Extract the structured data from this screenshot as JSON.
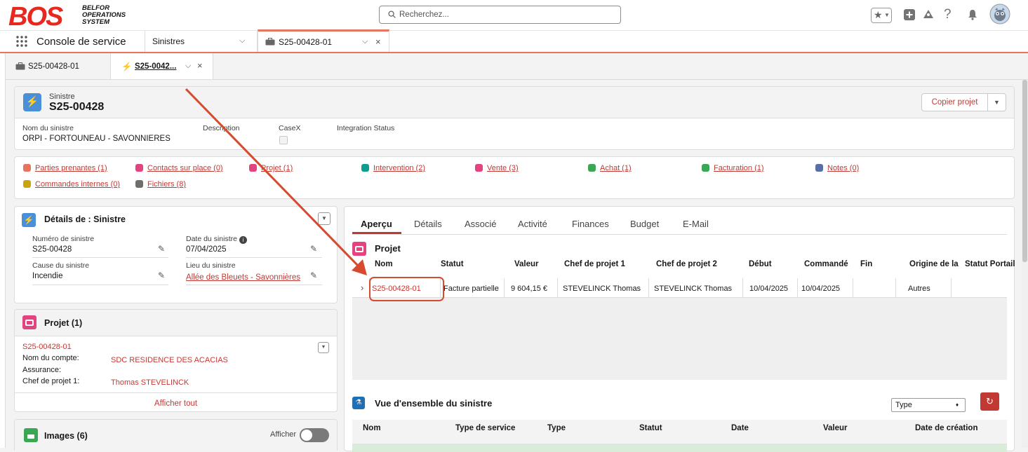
{
  "app": {
    "logo_text": "BOS",
    "logo_sub": [
      "BELFOR",
      "OPERATIONS",
      "SYSTEM"
    ],
    "search_placeholder": "Recherchez..."
  },
  "nav": {
    "console": "Console de service",
    "object_select": "Sinistres",
    "tab1": "S25-00428-01"
  },
  "subtabs": {
    "tab1": "S25-00428-01",
    "tab2": "S25-0042..."
  },
  "record": {
    "object_label": "Sinistre",
    "name": "S25-00428",
    "copy_button": "Copier projet",
    "fields": [
      {
        "label": "Nom du sinistre",
        "value": "ORPI - FORTOUNEAU - SAVONNIERES"
      },
      {
        "label": "Description",
        "value": ""
      },
      {
        "label": "CaseX",
        "value": ""
      },
      {
        "label": "Integration Status",
        "value": ""
      }
    ]
  },
  "related_links": [
    {
      "label": "Parties prenantes (1)",
      "color": "#e8735f"
    },
    {
      "label": "Contacts sur place (0)",
      "color": "#e3437f"
    },
    {
      "label": "Projet (1)",
      "color": "#e3437f"
    },
    {
      "label": "Intervention (2)",
      "color": "#0b9d91"
    },
    {
      "label": "Vente (3)",
      "color": "#e3437f"
    },
    {
      "label": "Achat (1)",
      "color": "#3ba755"
    },
    {
      "label": "Facturation (1)",
      "color": "#3ba755"
    },
    {
      "label": "Notes (0)",
      "color": "#5a6ea5"
    },
    {
      "label": "Commandes internes (0)",
      "color": "#c9a40f"
    },
    {
      "label": "Fichiers (8)",
      "color": "#706e6b"
    }
  ],
  "details": {
    "title": "Détails de : Sinistre",
    "fields": [
      {
        "label": "Numéro de sinistre",
        "value": "S25-00428"
      },
      {
        "label": "Date du sinistre",
        "value": "07/04/2025"
      },
      {
        "label": "Cause du sinistre",
        "value": "Incendie"
      },
      {
        "label": "Lieu du sinistre",
        "value": "Allée des Bleuets - Savonnières"
      }
    ]
  },
  "projet_card": {
    "title": "Projet (1)",
    "record_link": "S25-00428-01",
    "rows": [
      {
        "label": "Nom du compte:",
        "value": "SDC RESIDENCE DES ACACIAS"
      },
      {
        "label": "Assurance:",
        "value": ""
      },
      {
        "label": "Chef de projet 1:",
        "value": "Thomas STEVELINCK"
      }
    ],
    "view_all": "Afficher tout"
  },
  "images_card": {
    "title": "Images (6)",
    "toggle_label": "Afficher"
  },
  "main_tabs": [
    "Aperçu",
    "Détails",
    "Associé",
    "Activité",
    "Finances",
    "Budget",
    "E-Mail"
  ],
  "projet_table": {
    "title": "Projet",
    "columns": [
      "Nom",
      "Statut",
      "Valeur",
      "Chef de projet 1",
      "Chef de projet 2",
      "Début",
      "Commandé",
      "Fin",
      "Origine de la",
      "Statut Portail"
    ],
    "rows": [
      [
        "S25-00428-01",
        "Facture partielle",
        "9 604,15 €",
        "STEVELINCK Thomas",
        "STEVELINCK Thomas",
        "10/04/2025",
        "10/04/2025",
        "",
        "Autres",
        ""
      ]
    ]
  },
  "overview": {
    "title": "Vue d'ensemble du sinistre",
    "type_select": "Type",
    "columns": [
      "Nom",
      "Type de service",
      "Type",
      "Statut",
      "Date",
      "Valeur",
      "Date de création"
    ]
  },
  "colors": {
    "accent": "#c23934",
    "brand_red": "#e8281e",
    "nav_underline": "#e8735f"
  }
}
